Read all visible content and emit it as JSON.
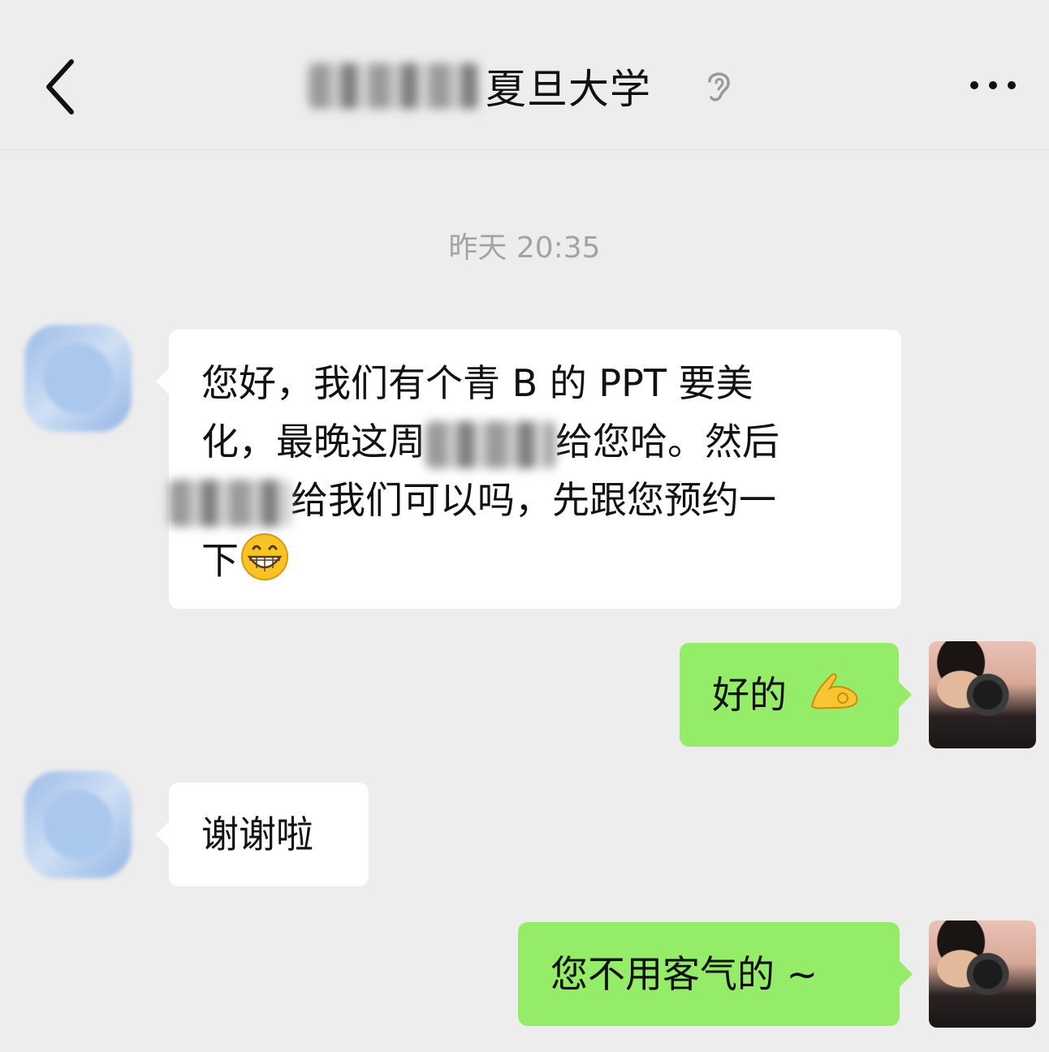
{
  "header": {
    "back_icon": "chevron-left-icon",
    "title": "夏旦大学",
    "title_prefix_redacted": true,
    "ear_icon": "earpiece-mode-icon",
    "more_icon": "more-dots-icon"
  },
  "timestamp": "昨天 20:35",
  "messages": [
    {
      "side": "left",
      "segments": [
        {
          "text": "您好，我们有个青 B 的 PPT 要美"
        },
        {
          "text": "化，最晚这周"
        },
        {
          "redacted": true
        },
        {
          "text": "给您哈。然后"
        },
        {
          "redacted": true
        },
        {
          "text": "给我们可以吗，先跟您预约一"
        },
        {
          "text": "下"
        },
        {
          "emoji": "grinning-face-emoji"
        }
      ]
    },
    {
      "side": "right",
      "text": "好的",
      "emoji": "ok-hand-emoji"
    },
    {
      "side": "left",
      "text": "谢谢啦"
    },
    {
      "side": "right",
      "text": "您不用客气的 ~"
    }
  ],
  "colors": {
    "background": "#ededed",
    "bubble_left": "#ffffff",
    "bubble_right": "#95ec69",
    "timestamp": "#a3a3a3",
    "text": "#111111"
  }
}
